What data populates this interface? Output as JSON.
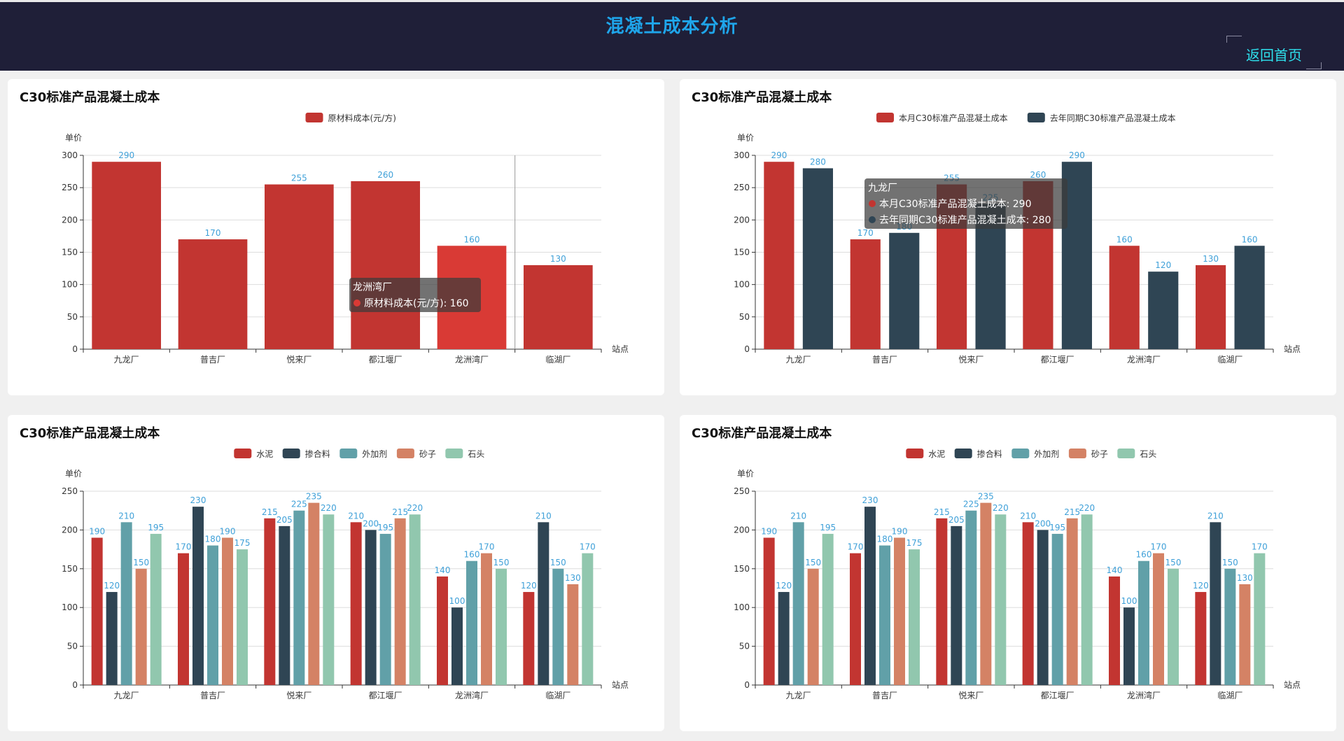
{
  "header": {
    "title": "混凝土成本分析",
    "home_label": "返回首页"
  },
  "colors": {
    "header_bg": "#1f1f38",
    "title": "#1fa5ea",
    "home": "#2ee0ec",
    "label": "#3fa0d8"
  },
  "chart_data": [
    {
      "type": "bar",
      "title": "C30标准产品混凝土成本",
      "ylabel": "单价",
      "xlabel": "站点",
      "ylim": [
        0,
        300
      ],
      "yticks": [
        0,
        50,
        100,
        150,
        200,
        250,
        300
      ],
      "categories": [
        "九龙厂",
        "普吉厂",
        "悦来厂",
        "都江堰厂",
        "龙洲湾厂",
        "临湖厂"
      ],
      "series": [
        {
          "name": "原材料成本(元/方)",
          "color": "#c23531",
          "values": [
            290,
            170,
            255,
            260,
            160,
            130
          ]
        }
      ],
      "highlight_index": 4,
      "highlight_color": "#d93a35",
      "tooltip": {
        "title": "龙洲湾厂",
        "lines": [
          "原材料成本(元/方): 160"
        ]
      }
    },
    {
      "type": "bar",
      "title": "C30标准产品混凝土成本",
      "ylabel": "单价",
      "xlabel": "站点",
      "ylim": [
        0,
        300
      ],
      "yticks": [
        0,
        50,
        100,
        150,
        200,
        250,
        300
      ],
      "categories": [
        "九龙厂",
        "普吉厂",
        "悦来厂",
        "都江堰厂",
        "龙洲湾厂",
        "临湖厂"
      ],
      "series": [
        {
          "name": "本月C30标准产品混凝土成本",
          "color": "#c23531",
          "values": [
            290,
            170,
            255,
            260,
            160,
            130
          ]
        },
        {
          "name": "去年同期C30标准产品混凝土成本",
          "color": "#2f4554",
          "values": [
            280,
            180,
            225,
            290,
            120,
            160
          ]
        }
      ],
      "tooltip": {
        "title": "九龙厂",
        "lines": [
          "本月C30标准产品混凝土成本: 290",
          "去年同期C30标准产品混凝土成本: 280"
        ]
      }
    },
    {
      "type": "bar",
      "title": "C30标准产品混凝土成本",
      "ylabel": "单价",
      "xlabel": "站点",
      "ylim": [
        0,
        250
      ],
      "yticks": [
        0,
        50,
        100,
        150,
        200,
        250
      ],
      "categories": [
        "九龙厂",
        "普吉厂",
        "悦来厂",
        "都江堰厂",
        "龙洲湾厂",
        "临湖厂"
      ],
      "series": [
        {
          "name": "水泥",
          "color": "#c23531",
          "values": [
            190,
            170,
            215,
            210,
            140,
            120
          ]
        },
        {
          "name": "掺合料",
          "color": "#2f4554",
          "values": [
            120,
            230,
            205,
            200,
            100,
            210
          ]
        },
        {
          "name": "外加剂",
          "color": "#61a0a8",
          "values": [
            210,
            180,
            225,
            195,
            160,
            150
          ]
        },
        {
          "name": "砂子",
          "color": "#d48265",
          "values": [
            150,
            190,
            235,
            215,
            170,
            130
          ]
        },
        {
          "name": "石头",
          "color": "#91c7ae",
          "values": [
            195,
            175,
            220,
            220,
            150,
            170
          ]
        }
      ]
    },
    {
      "type": "bar",
      "title": "C30标准产品混凝土成本",
      "ylabel": "单价",
      "xlabel": "站点",
      "ylim": [
        0,
        250
      ],
      "yticks": [
        0,
        50,
        100,
        150,
        200,
        250
      ],
      "categories": [
        "九龙厂",
        "普吉厂",
        "悦来厂",
        "都江堰厂",
        "龙洲湾厂",
        "临湖厂"
      ],
      "series": [
        {
          "name": "水泥",
          "color": "#c23531",
          "values": [
            190,
            170,
            215,
            210,
            140,
            120
          ]
        },
        {
          "name": "掺合料",
          "color": "#2f4554",
          "values": [
            120,
            230,
            205,
            200,
            100,
            210
          ]
        },
        {
          "name": "外加剂",
          "color": "#61a0a8",
          "values": [
            210,
            180,
            225,
            195,
            160,
            150
          ]
        },
        {
          "name": "砂子",
          "color": "#d48265",
          "values": [
            150,
            190,
            235,
            215,
            170,
            130
          ]
        },
        {
          "name": "石头",
          "color": "#91c7ae",
          "values": [
            195,
            175,
            220,
            220,
            150,
            170
          ]
        }
      ]
    }
  ]
}
